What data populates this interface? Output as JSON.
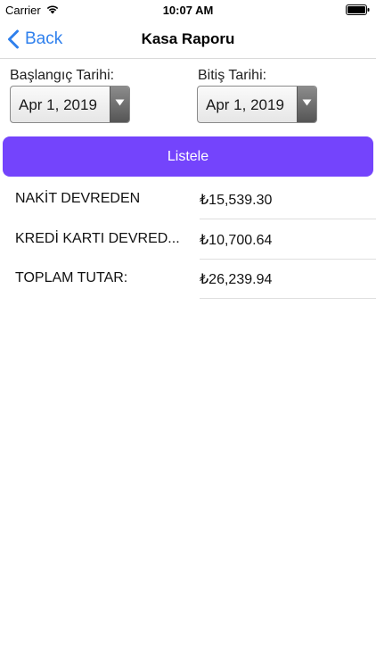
{
  "status_bar": {
    "carrier": "Carrier",
    "time": "10:07 AM"
  },
  "nav": {
    "back_label": "Back",
    "title": "Kasa Raporu"
  },
  "filters": {
    "start_label": "Başlangıç Tarihi:",
    "start_value": "Apr 1, 2019",
    "end_label": "Bitiş Tarihi:",
    "end_value": "Apr 1, 2019"
  },
  "list_button": {
    "label": "Listele",
    "color": "#7444fc"
  },
  "summary": [
    {
      "label": "NAKİT DEVREDEN",
      "value": "₺15,539.30"
    },
    {
      "label": "KREDİ KARTI DEVRED...",
      "value": "₺10,700.64"
    },
    {
      "label": "TOPLAM TUTAR:",
      "value": "₺26,239.94"
    }
  ],
  "accent_color": "#2f80ed"
}
